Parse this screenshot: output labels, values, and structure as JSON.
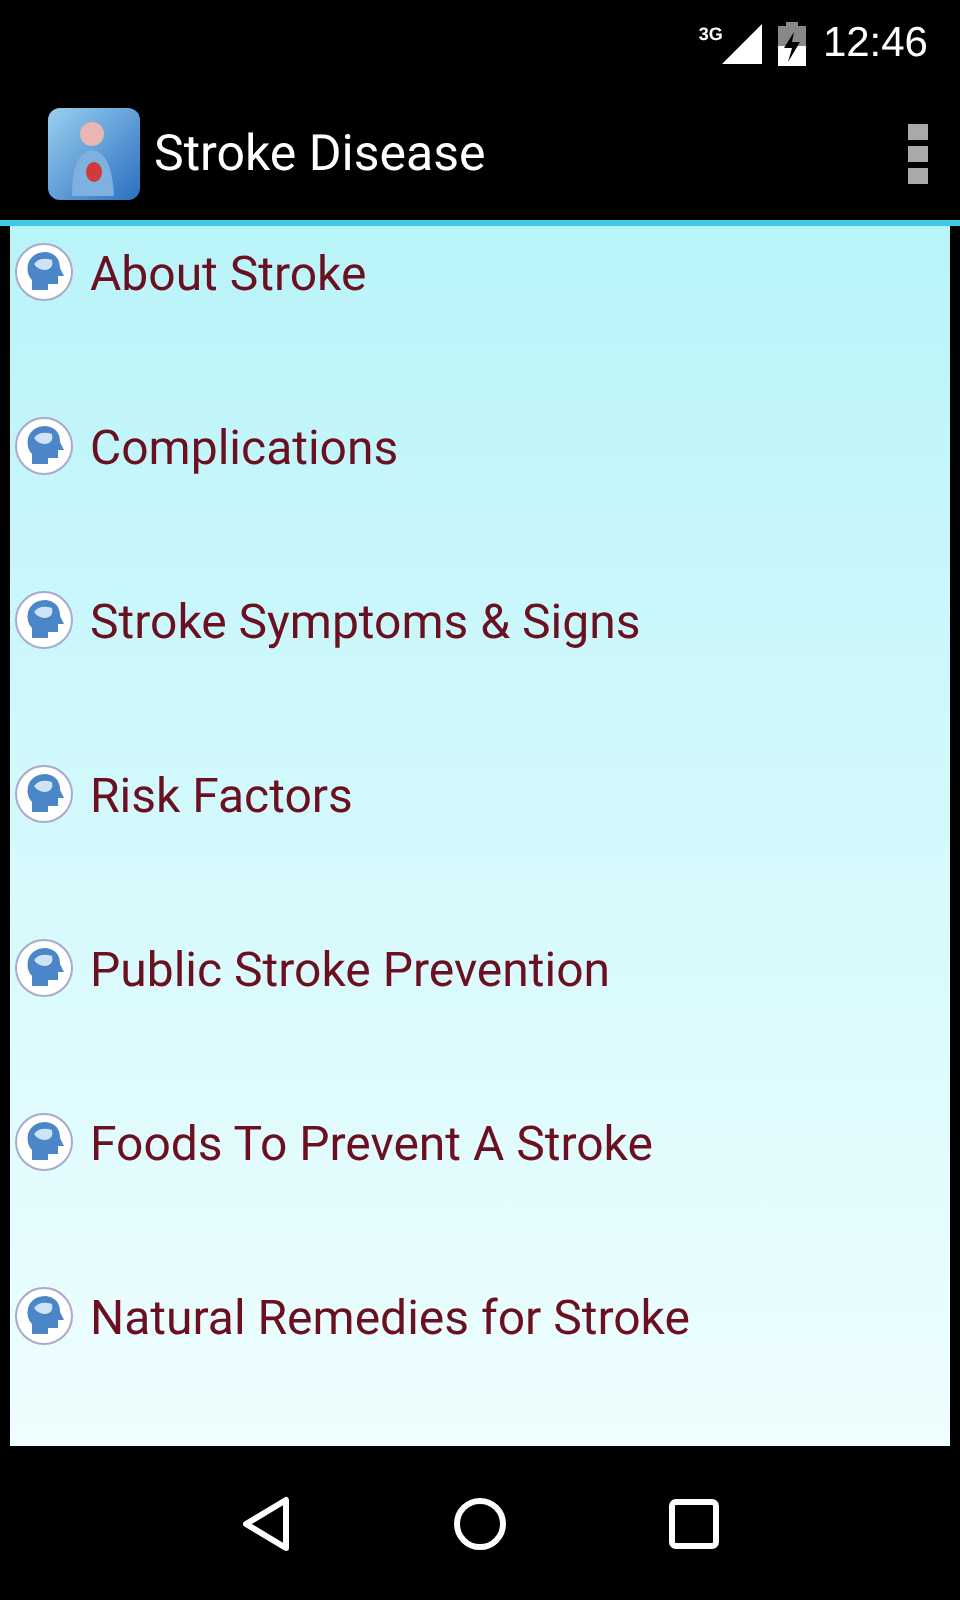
{
  "status_bar": {
    "network": "3G",
    "time": "12:46"
  },
  "app_bar": {
    "title": "Stroke Disease"
  },
  "topics": [
    {
      "label": "About Stroke"
    },
    {
      "label": "Complications"
    },
    {
      "label": "Stroke Symptoms & Signs"
    },
    {
      "label": "Risk Factors"
    },
    {
      "label": "Public Stroke Prevention"
    },
    {
      "label": "Foods To Prevent A Stroke"
    },
    {
      "label": "Natural Remedies for Stroke"
    }
  ]
}
